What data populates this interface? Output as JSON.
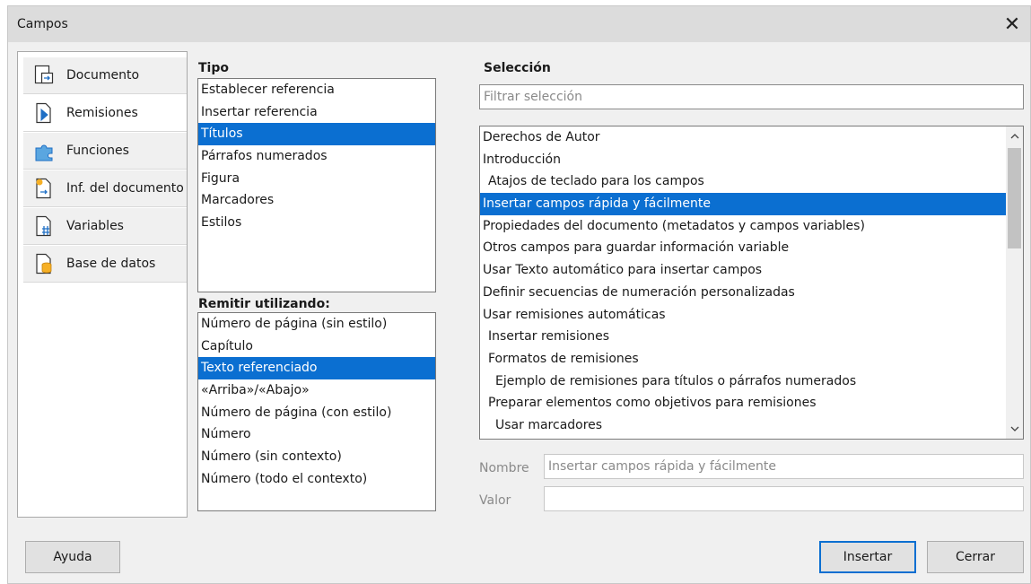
{
  "window": {
    "title": "Campos",
    "close_glyph": "✕"
  },
  "sidebar": {
    "items": [
      {
        "label": "Documento",
        "icon": "document-field-icon"
      },
      {
        "label": "Remisiones",
        "icon": "cross-reference-icon"
      },
      {
        "label": "Funciones",
        "icon": "functions-icon"
      },
      {
        "label": "Inf. del documento",
        "icon": "document-info-icon"
      },
      {
        "label": "Variables",
        "icon": "variables-icon"
      },
      {
        "label": "Base de datos",
        "icon": "database-icon"
      }
    ],
    "selected_index": 1
  },
  "tipo": {
    "header": "Tipo",
    "items": [
      "Establecer referencia",
      "Insertar referencia",
      "Títulos",
      "Párrafos numerados",
      "Figura",
      "Marcadores",
      "Estilos"
    ],
    "selected_index": 2
  },
  "remitir": {
    "header": "Remitir utilizando:",
    "items": [
      "Número de página (sin estilo)",
      "Capítulo",
      "Texto referenciado",
      "«Arriba»/«Abajo»",
      "Número de página (con estilo)",
      "Número",
      "Número (sin contexto)",
      "Número (todo el contexto)"
    ],
    "selected_index": 2
  },
  "seleccion": {
    "header": "Selección",
    "filter_placeholder": "Filtrar selección",
    "items": [
      {
        "text": "Derechos de Autor",
        "indent": 0
      },
      {
        "text": "Introducción",
        "indent": 0
      },
      {
        "text": "Atajos de teclado para los campos",
        "indent": 1
      },
      {
        "text": "Insertar campos rápida y fácilmente",
        "indent": 0
      },
      {
        "text": "Propiedades del documento (metadatos y campos variables)",
        "indent": 0
      },
      {
        "text": "Otros campos para guardar información variable",
        "indent": 0
      },
      {
        "text": "Usar Texto automático para insertar campos",
        "indent": 0
      },
      {
        "text": "Definir secuencias de numeración personalizadas",
        "indent": 0
      },
      {
        "text": "Usar remisiones automáticas",
        "indent": 0
      },
      {
        "text": "Insertar remisiones",
        "indent": 1
      },
      {
        "text": "Formatos de remisiones",
        "indent": 1
      },
      {
        "text": "Ejemplo de remisiones para títulos o párrafos numerados",
        "indent": 2
      },
      {
        "text": "Preparar elementos como objetivos para remisiones",
        "indent": 1
      },
      {
        "text": "Usar marcadores",
        "indent": 2
      }
    ],
    "selected_index": 3
  },
  "nombre": {
    "label": "Nombre",
    "value": "Insertar campos rápida y fácilmente"
  },
  "valor": {
    "label": "Valor",
    "value": ""
  },
  "buttons": {
    "help": "Ayuda",
    "insert": "Insertar",
    "close": "Cerrar"
  },
  "colors": {
    "selection": "#0b6fd1",
    "dialog_bg": "#f0f0f0",
    "titlebar_bg": "#dcdcdc"
  }
}
